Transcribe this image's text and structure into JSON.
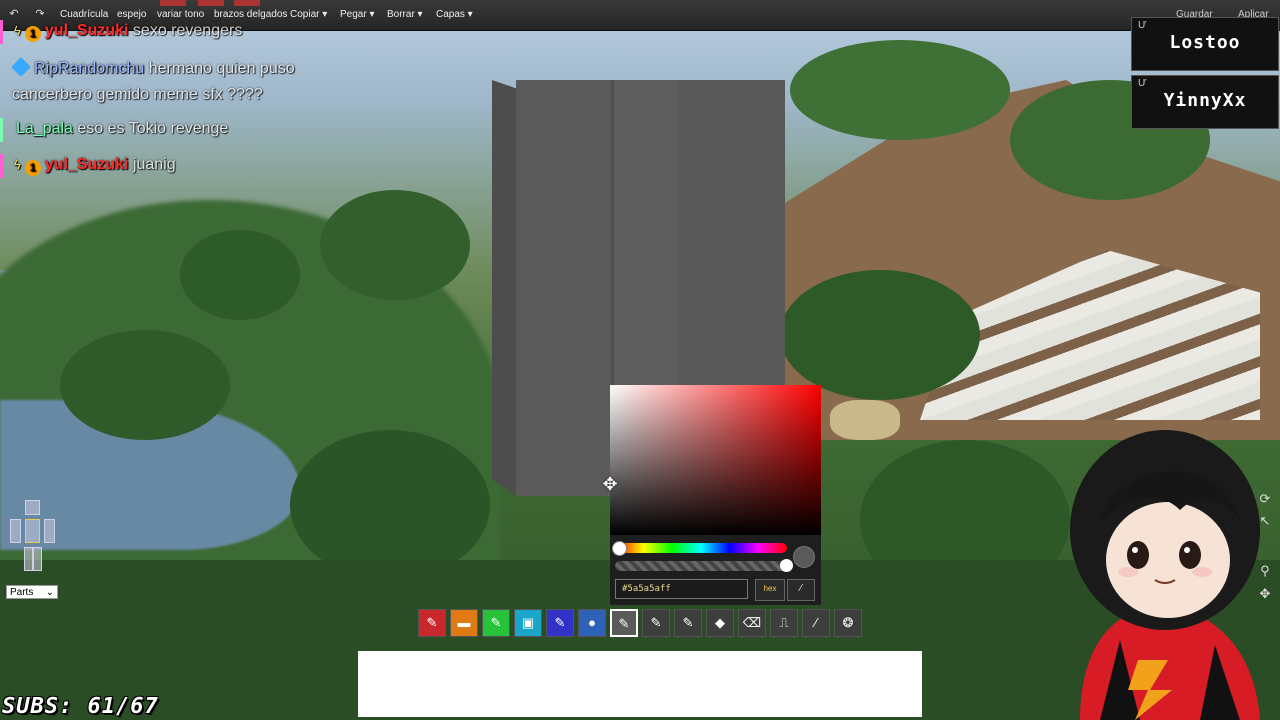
{
  "toolbar": {
    "items": [
      "Cuadrícula",
      "espejo",
      "variar tono",
      "brazos delgados",
      "Copiar ▾",
      "Pegar ▾",
      "Borrar ▾",
      "Capas ▾"
    ],
    "right": [
      "Guardar",
      "Aplicar"
    ]
  },
  "chat": [
    {
      "user": "yul_Suzuki",
      "message": "sexo revengers"
    },
    {
      "user": "RipRandomchu",
      "message": "hermano quien puso"
    },
    {
      "user": "",
      "message": "cancerbero gemido meme sfx ????"
    },
    {
      "user": "La_pala",
      "message": "eso es Tokio revenge"
    },
    {
      "user": "yul_Suzuki",
      "message": "juanig"
    }
  ],
  "names": [
    "Lostoo",
    "YinnyXx"
  ],
  "picker": {
    "hex_value": "#5a5a5aff",
    "hex_button": "hex",
    "hue_color": "#ff0000",
    "preview_color": "#5a5a5a"
  },
  "tools": [
    {
      "name": "pencil-red-tool",
      "color": "#c8282c",
      "glyph": "✎"
    },
    {
      "name": "gradient-tool",
      "color": "#e07a14",
      "glyph": "▬"
    },
    {
      "name": "pencil-green-tool",
      "color": "#27c13a",
      "glyph": "✎"
    },
    {
      "name": "fill-cyan-tool",
      "color": "#1aa6c8",
      "glyph": "▣"
    },
    {
      "name": "pencil-blue-tool",
      "color": "#3232c8",
      "glyph": "✎"
    },
    {
      "name": "circle-blue-tool",
      "color": "#2e62b8",
      "glyph": "●"
    },
    {
      "name": "pencil-gray-tool",
      "color": "#5a5a5a",
      "glyph": "✎"
    },
    {
      "name": "pencil-gray-tool-2",
      "color": "#3e3e3e",
      "glyph": "✎"
    },
    {
      "name": "pencil-gray-tool-3",
      "color": "#3e3e3e",
      "glyph": "✎"
    },
    {
      "name": "bucket-tool",
      "color": "#3e3e3e",
      "glyph": "◆"
    },
    {
      "name": "eraser-tool",
      "color": "#3e3e3e",
      "glyph": "⌫"
    },
    {
      "name": "stamp-tool",
      "color": "#3e3e3e",
      "glyph": "⎍"
    },
    {
      "name": "eyedropper-tool",
      "color": "#3e3e3e",
      "glyph": "⁄"
    },
    {
      "name": "palette-tool",
      "color": "#3e3e3e",
      "glyph": "❂"
    }
  ],
  "parts_select": "Parts",
  "subs_counter": "SUBS: 61/67"
}
